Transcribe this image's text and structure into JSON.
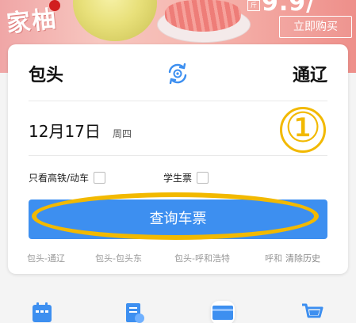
{
  "banner": {
    "calligraphy": "家柚",
    "small_tag": "斤",
    "top_text": "9.9/",
    "buy_button": "立即购买"
  },
  "route": {
    "from_city": "包头",
    "to_city": "通辽",
    "swap_icon": "swap-cycle-icon"
  },
  "date": {
    "main": "12月17日",
    "weekday": "周四"
  },
  "annotation_number": "①",
  "options": {
    "gaotie_label": "只看高铁/动车",
    "student_label": "学生票"
  },
  "search_button_label": "查询车票",
  "history": {
    "items": [
      "包头-通辽",
      "包头-包头东",
      "包头-呼和浩特",
      "呼和"
    ],
    "clear_label": "清除历史"
  },
  "bottom_icons": [
    "calendar-icon",
    "document-icon",
    "card-icon",
    "cart-icon"
  ],
  "colors": {
    "accent": "#3d8ff0",
    "annotation": "#f2b900",
    "banner": "#f0a6a6"
  }
}
